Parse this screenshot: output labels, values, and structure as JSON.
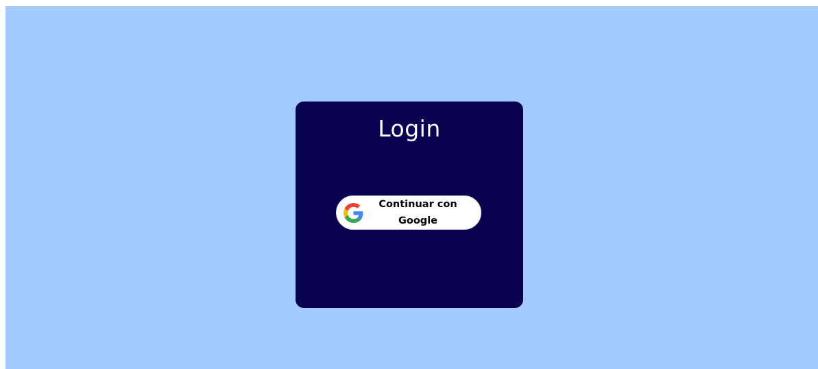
{
  "login": {
    "title": "Login",
    "google_button_label": "Continuar con Google",
    "google_icon": "google-g-icon"
  },
  "colors": {
    "background": "#a4cbff",
    "card": "#0a0352",
    "button": "#ffffff",
    "google_blue": "#4285F4",
    "google_red": "#EA4335",
    "google_yellow": "#FBBC05",
    "google_green": "#34A853"
  }
}
